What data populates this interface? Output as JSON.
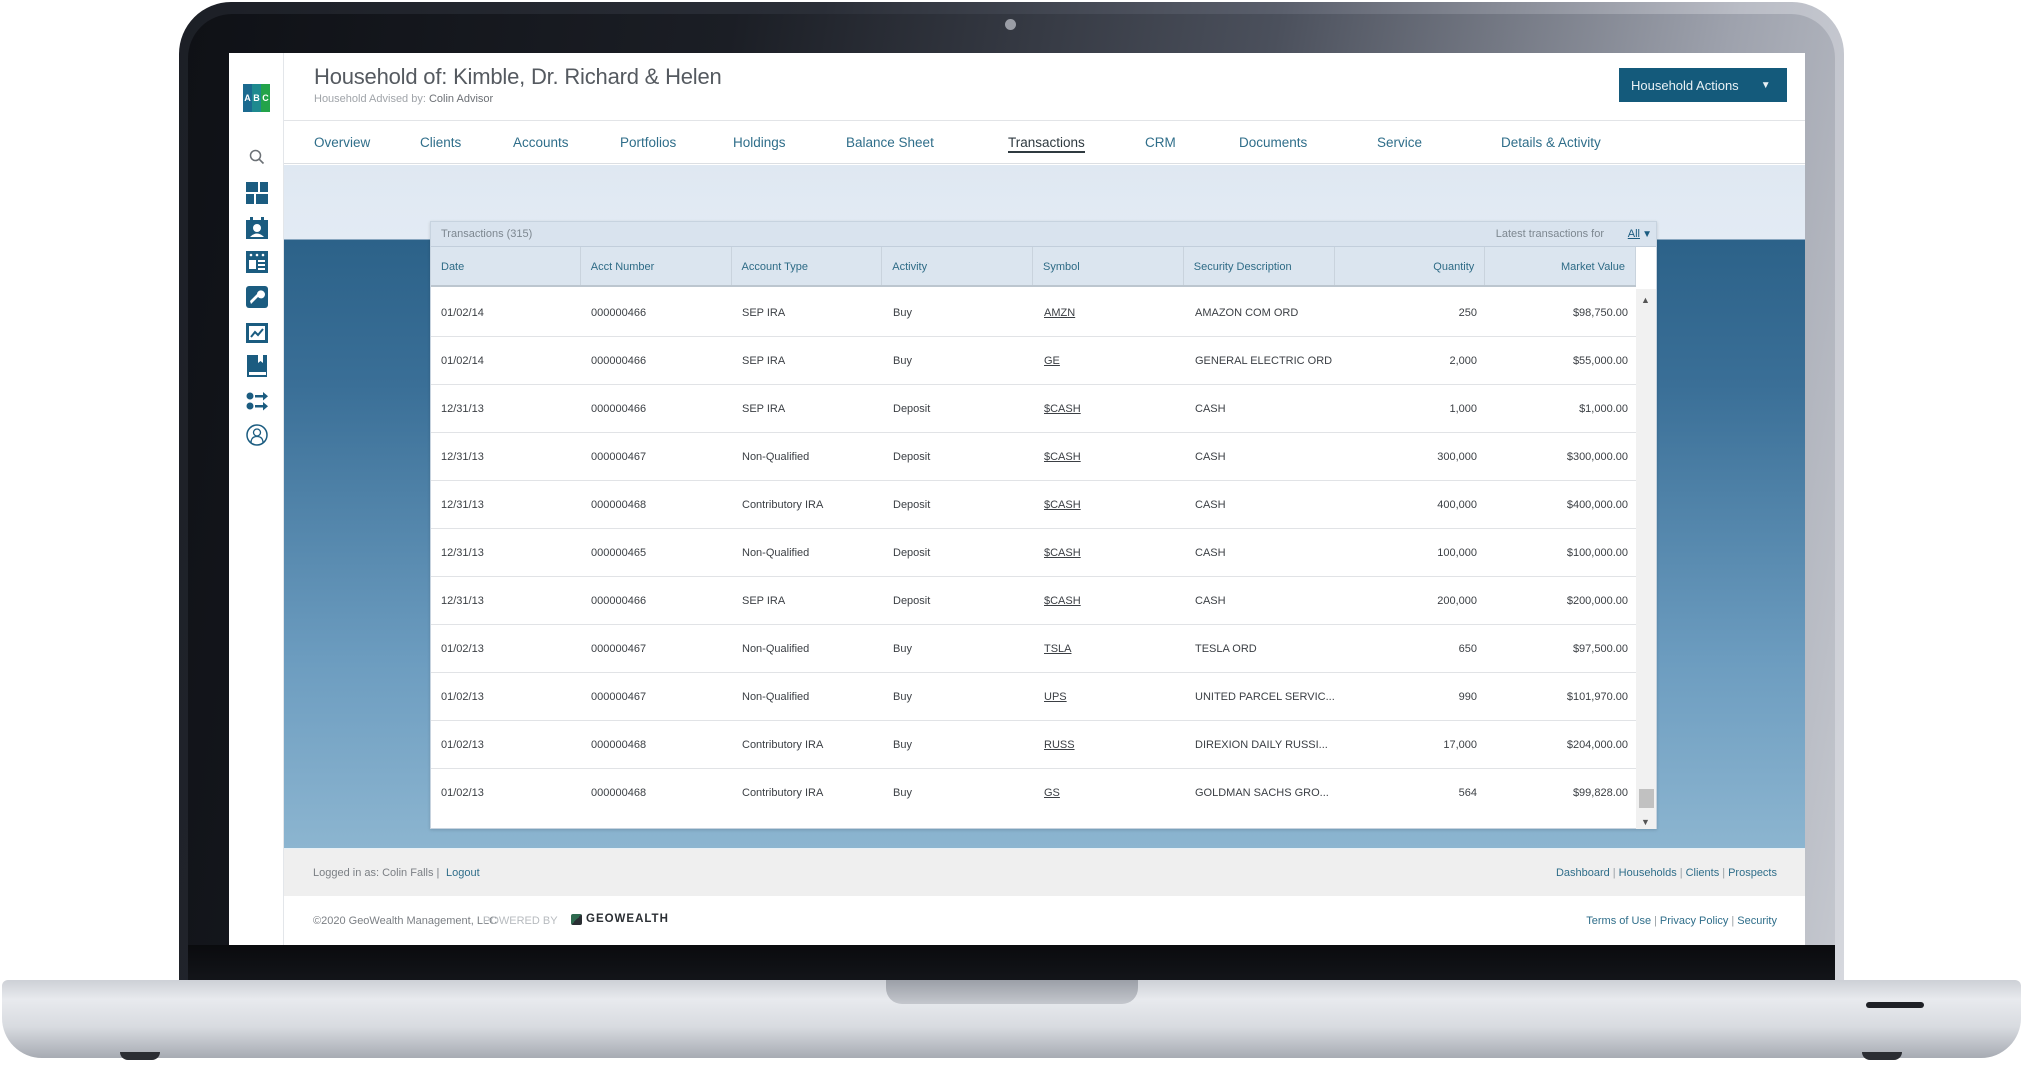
{
  "header": {
    "title": "Household of: Kimble, Dr. Richard & Helen",
    "advised_by_label": "Household Advised by:",
    "advised_by_name": "Colin Advisor",
    "add_icon": "plus-icon",
    "actions_button": "Household Actions",
    "actions_caret": "▼"
  },
  "logo": {
    "letters": [
      "A",
      "B",
      "C"
    ],
    "colors": [
      "#1b6a8f",
      "#1e8a8f",
      "#23a34a"
    ]
  },
  "sidebar": {
    "icons": [
      "search-icon",
      "dashboard-icon",
      "calendar-contact-icon",
      "contact-card-icon",
      "wrench-icon",
      "chart-report-icon",
      "book-icon",
      "transfer-icon",
      "user-profile-icon"
    ]
  },
  "nav": {
    "tabs": [
      {
        "label": "Overview"
      },
      {
        "label": "Clients"
      },
      {
        "label": "Accounts"
      },
      {
        "label": "Portfolios"
      },
      {
        "label": "Holdings"
      },
      {
        "label": "Balance Sheet"
      },
      {
        "label": "Transactions",
        "active": true
      },
      {
        "label": "CRM"
      },
      {
        "label": "Documents"
      },
      {
        "label": "Service"
      },
      {
        "label": "Details & Activity"
      }
    ]
  },
  "transactions": {
    "title": "Transactions (315)",
    "filter_label": "Latest transactions for",
    "filter_value": "All",
    "filter_caret": "▼",
    "columns": [
      "Date",
      "Acct Number",
      "Account Type",
      "Activity",
      "Symbol",
      "Security Description",
      "Quantity",
      "Market Value"
    ],
    "rows": [
      [
        "01/02/14",
        "000000466",
        "SEP IRA",
        "Buy",
        "AMZN",
        "AMAZON COM ORD",
        "250",
        "$98,750.00"
      ],
      [
        "01/02/14",
        "000000466",
        "SEP IRA",
        "Buy",
        "GE",
        "GENERAL ELECTRIC ORD",
        "2,000",
        "$55,000.00"
      ],
      [
        "12/31/13",
        "000000466",
        "SEP IRA",
        "Deposit",
        "$CASH",
        "CASH",
        "1,000",
        "$1,000.00"
      ],
      [
        "12/31/13",
        "000000467",
        "Non-Qualified",
        "Deposit",
        "$CASH",
        "CASH",
        "300,000",
        "$300,000.00"
      ],
      [
        "12/31/13",
        "000000468",
        "Contributory IRA",
        "Deposit",
        "$CASH",
        "CASH",
        "400,000",
        "$400,000.00"
      ],
      [
        "12/31/13",
        "000000465",
        "Non-Qualified",
        "Deposit",
        "$CASH",
        "CASH",
        "100,000",
        "$100,000.00"
      ],
      [
        "12/31/13",
        "000000466",
        "SEP IRA",
        "Deposit",
        "$CASH",
        "CASH",
        "200,000",
        "$200,000.00"
      ],
      [
        "01/02/13",
        "000000467",
        "Non-Qualified",
        "Buy",
        "TSLA",
        "TESLA ORD",
        "650",
        "$97,500.00"
      ],
      [
        "01/02/13",
        "000000467",
        "Non-Qualified",
        "Buy",
        "UPS",
        "UNITED PARCEL SERVIC...",
        "990",
        "$101,970.00"
      ],
      [
        "01/02/13",
        "000000468",
        "Contributory IRA",
        "Buy",
        "RUSS",
        "DIREXION DAILY RUSSI...",
        "17,000",
        "$204,000.00"
      ],
      [
        "01/02/13",
        "000000468",
        "Contributory IRA",
        "Buy",
        "GS",
        "GOLDMAN SACHS GRO...",
        "564",
        "$99,828.00"
      ]
    ],
    "scroll_up": "▲",
    "scroll_down": "▼"
  },
  "footer": {
    "logged_in": "Logged in as: Colin Falls |",
    "logout": "Logout",
    "quick_links": [
      "Dashboard",
      "Households",
      "Clients",
      "Prospects"
    ],
    "copyright": "©2020 GeoWealth Management, LLC",
    "powered_by": "POWERED BY",
    "brand": "GEOWEALTH",
    "legal_links": [
      "Terms of Use",
      "Privacy Policy",
      "Security"
    ]
  }
}
